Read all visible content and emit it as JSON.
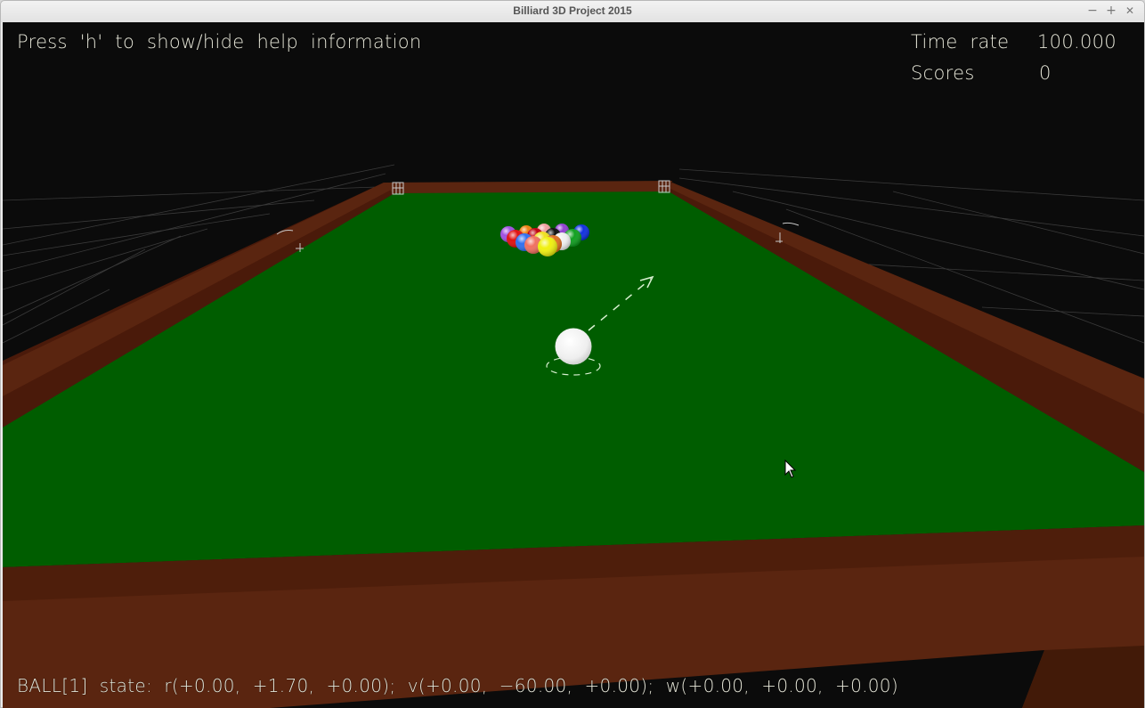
{
  "window": {
    "title": "Billiard 3D Project 2015",
    "controls": {
      "minimize": "−",
      "maximize": "+",
      "close": "✕"
    }
  },
  "hud": {
    "help_hint": "Press  'h'  to  show/hide  help  information",
    "time_rate_label": "Time  rate",
    "time_rate_value": "100.000",
    "scores_label": "Scores",
    "scores_value": "0",
    "ball_state": "BALL[1]  state:  r(+0.00,  +1.70,  +0.00);  v(+0.00,  −60.00,  +0.00);  w(+0.00,  +0.00,  +0.00)"
  },
  "scene": {
    "colors": {
      "background": "#0b0b0b",
      "cloth": "#005d00",
      "rail": "#5a2510",
      "rail_dark": "#45190a",
      "grid": "#3a3a3a",
      "cue_ball": "#f2f2f2",
      "aim_line": "#d8f0d0"
    },
    "object_balls": [
      {
        "color": "#a050e0"
      },
      {
        "color": "#f08010"
      },
      {
        "color": "#f0a0a0"
      },
      {
        "color": "#9040d0"
      },
      {
        "color": "#1030e0"
      },
      {
        "color": "#e01010"
      },
      {
        "color": "#c00010"
      },
      {
        "color": "#101010"
      },
      {
        "color": "#10a020"
      },
      {
        "color": "#3070f0"
      },
      {
        "color": "#f0e020"
      },
      {
        "color": "#f0f0f0"
      },
      {
        "color": "#f07060"
      },
      {
        "color": "#e07020"
      },
      {
        "color": "#f0f010"
      }
    ]
  }
}
